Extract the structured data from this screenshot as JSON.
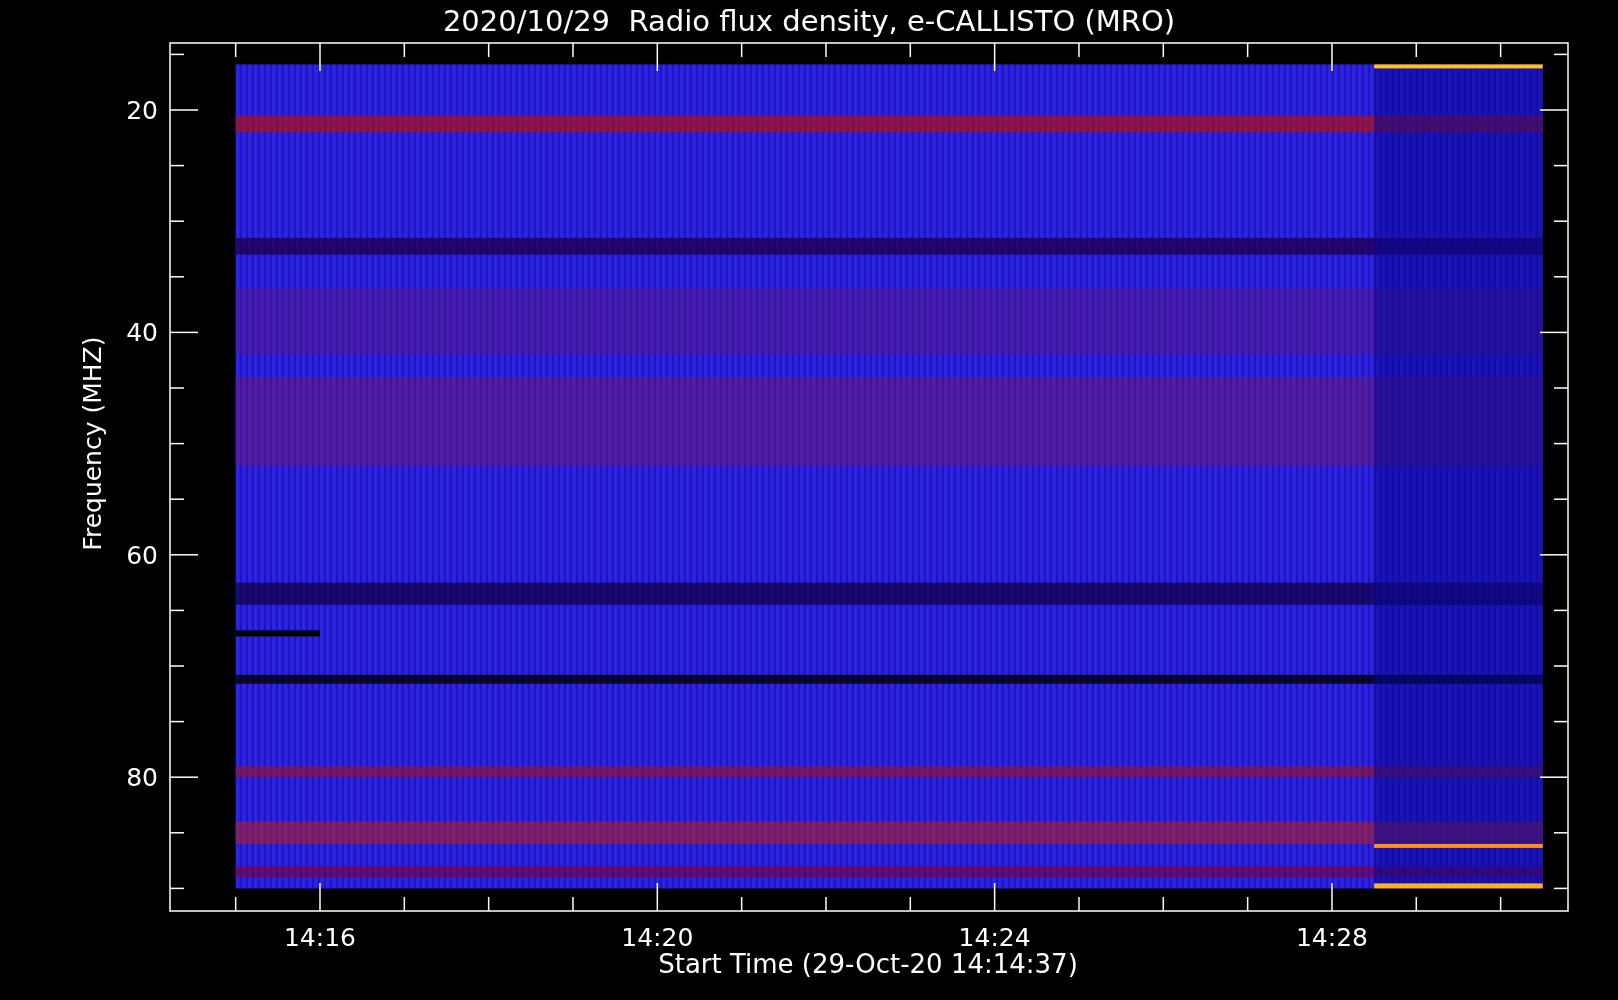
{
  "title": "2020/10/29  Radio flux density, e-CALLISTO (MRO)",
  "y_axis": {
    "label": "Frequency (MHZ)",
    "ticks": [
      "20",
      "40",
      "60",
      "80"
    ]
  },
  "x_axis": {
    "label": "Start Time (29-Oct-20 14:14:37)",
    "ticks": [
      "14:16",
      "14:20",
      "14:24",
      "14:28"
    ]
  }
}
